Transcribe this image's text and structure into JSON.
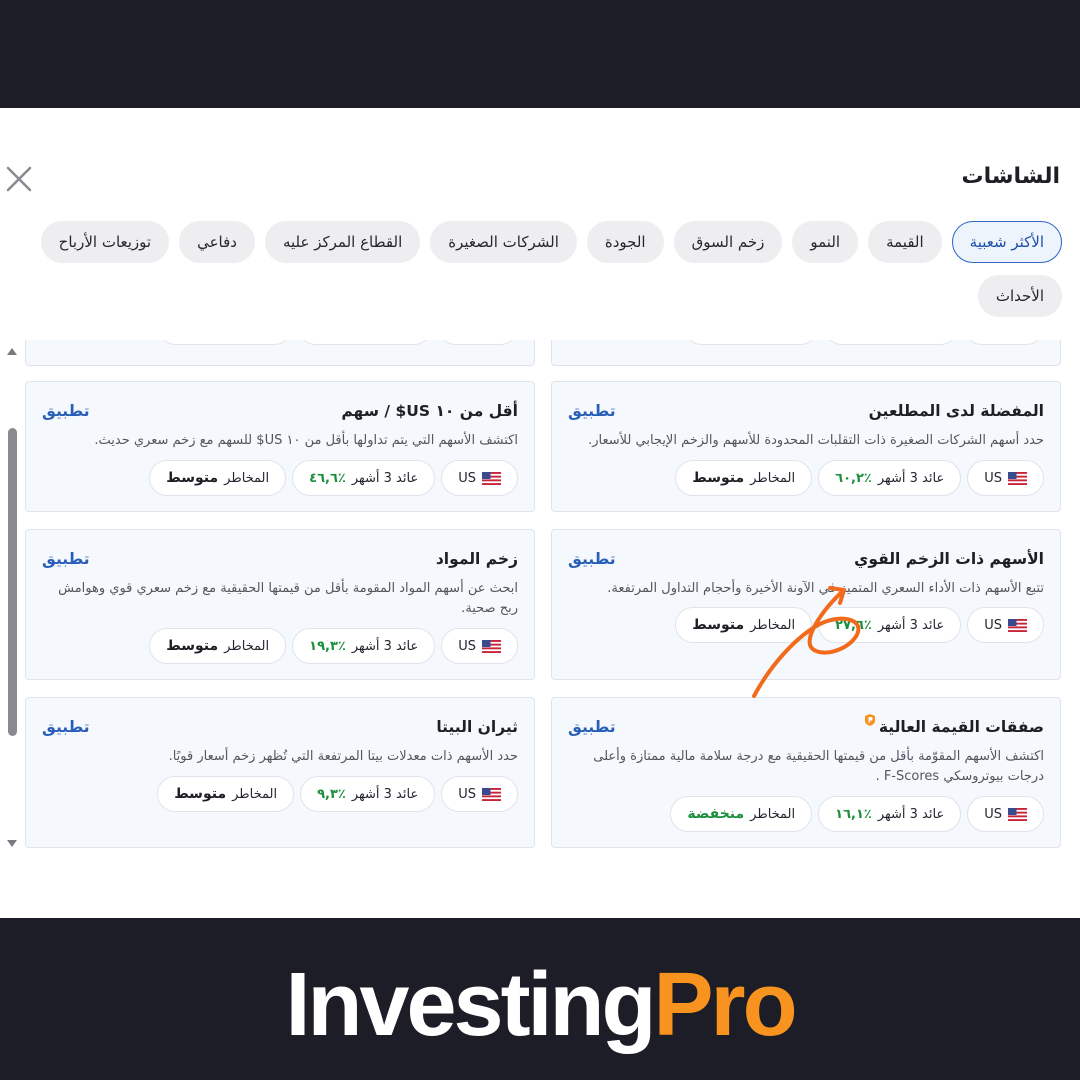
{
  "panel": {
    "title": "الشاشات",
    "close_label": "×"
  },
  "tabs": [
    {
      "label": "الأكثر شعبية",
      "active": true
    },
    {
      "label": "القيمة"
    },
    {
      "label": "النمو"
    },
    {
      "label": "زخم السوق"
    },
    {
      "label": "الجودة"
    },
    {
      "label": "الشركات الصغيرة"
    },
    {
      "label": "القطاع المركز عليه"
    },
    {
      "label": "دفاعي"
    },
    {
      "label": "توزيعات الأرباح"
    },
    {
      "label": "الأحداث"
    }
  ],
  "cards": [
    {
      "title": "المفضلة لدى المطلعين",
      "apply": "تطبيق",
      "description": "حدد أسهم الشركات الصغيرة ذات التقلبات المحدودة للأسهم والزخم الإيجابي للأسعار.",
      "region": "US",
      "return_label": "عائد 3 أشهر",
      "return_value": "٪٦٠,٢",
      "risk_label": "المخاطر",
      "risk_value": "متوسط"
    },
    {
      "title": "أقل من ١٠ US$ / سهم",
      "apply": "تطبيق",
      "description": "اكتشف الأسهم التي يتم تداولها بأقل من ١٠ US$ للسهم مع زخم سعري حديث.",
      "region": "US",
      "return_label": "عائد 3 أشهر",
      "return_value": "٪٤٦,٦",
      "risk_label": "المخاطر",
      "risk_value": "متوسط"
    },
    {
      "title": "الأسهم ذات الزخم القوي",
      "apply": "تطبيق",
      "description": "تتبع الأسهم ذات الأداء السعري المتميز في الآونة الأخيرة وأحجام التداول المرتفعة.",
      "region": "US",
      "return_label": "عائد 3 أشهر",
      "return_value": "٪٢٧,٦",
      "risk_label": "المخاطر",
      "risk_value": "متوسط"
    },
    {
      "title": "زخم المواد",
      "apply": "تطبيق",
      "description": "ابحث عن أسهم المواد المقومة بأقل من قيمتها الحقيقية مع زخم سعري قوي وهوامش ربح صحية.",
      "region": "US",
      "return_label": "عائد 3 أشهر",
      "return_value": "٪١٩,٣",
      "risk_label": "المخاطر",
      "risk_value": "متوسط"
    },
    {
      "title": "صفقات القيمة العالية",
      "apply": "تطبيق",
      "description": "اكتشف الأسهم المقوّمة بأقل من قيمتها الحقيقية مع درجة سلامة مالية ممتازة وأعلى درجات بيوتروسكي F-Scores .",
      "region": "US",
      "return_label": "عائد 3 أشهر",
      "return_value": "٪١٦,١",
      "risk_label": "المخاطر",
      "risk_value": "منخفضة"
    },
    {
      "title": "ثيران البيتا",
      "apply": "تطبيق",
      "description": "حدد الأسهم ذات معدلات بيتا المرتفعة التي تُظهر زخم أسعار قويًا.",
      "region": "US",
      "return_label": "عائد 3 أشهر",
      "return_value": "٪٩,٣",
      "risk_label": "المخاطر",
      "risk_value": "متوسط"
    }
  ],
  "brand": {
    "part1": "Investing",
    "part2": "Pro"
  },
  "colors": {
    "dark_band": "#1c1d26",
    "accent_blue": "#2a5fb8",
    "positive_green": "#1b8f3c",
    "brand_orange": "#f7931e"
  }
}
